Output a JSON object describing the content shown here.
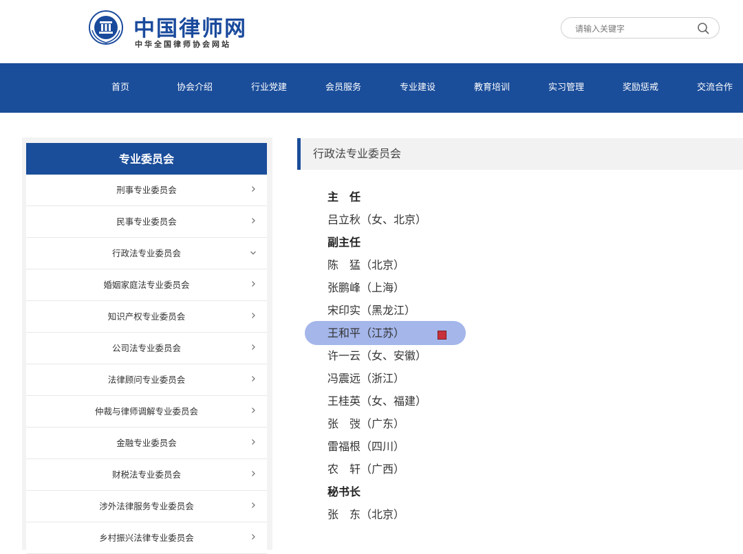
{
  "header": {
    "logo_title": "中国律师网",
    "logo_subtitle": "中华全国律师协会网站",
    "search_placeholder": "请输入关键字"
  },
  "nav": {
    "items": [
      "首页",
      "协会介绍",
      "行业党建",
      "会员服务",
      "专业建设",
      "教育培训",
      "实习管理",
      "奖励惩戒",
      "交流合作"
    ]
  },
  "sidebar": {
    "title": "专业委员会",
    "items": [
      {
        "label": "刑事专业委员会",
        "expanded": false
      },
      {
        "label": "民事专业委员会",
        "expanded": false
      },
      {
        "label": "行政法专业委员会",
        "expanded": true
      },
      {
        "label": "婚姻家庭法专业委员会",
        "expanded": false
      },
      {
        "label": "知识产权专业委员会",
        "expanded": false
      },
      {
        "label": "公司法专业委员会",
        "expanded": false
      },
      {
        "label": "法律顾问专业委员会",
        "expanded": false
      },
      {
        "label": "仲裁与律师调解专业委员会",
        "expanded": false
      },
      {
        "label": "金融专业委员会",
        "expanded": false
      },
      {
        "label": "财税法专业委员会",
        "expanded": false
      },
      {
        "label": "涉外法律服务专业委员会",
        "expanded": false
      },
      {
        "label": "乡村振兴法律专业委员会",
        "expanded": false
      }
    ]
  },
  "content": {
    "title": "行政法专业委员会",
    "lines": [
      {
        "text": "主　任",
        "role": true
      },
      {
        "text": "吕立秋（女、北京）",
        "role": false
      },
      {
        "text": "副主任",
        "role": true
      },
      {
        "text": "陈　猛（北京）",
        "role": false
      },
      {
        "text": "张鹏峰（上海）",
        "role": false
      },
      {
        "text": "宋印实（黑龙江）",
        "role": false
      },
      {
        "text": "王和平（江苏）",
        "role": false
      },
      {
        "text": "许一云（女、安徽）",
        "role": false
      },
      {
        "text": "冯震远（浙江）",
        "role": false
      },
      {
        "text": "王桂英（女、福建）",
        "role": false
      },
      {
        "text": "张　弢（广东）",
        "role": false
      },
      {
        "text": "雷福根（四川）",
        "role": false
      },
      {
        "text": "农　轩（广西）",
        "role": false
      },
      {
        "text": "秘书长",
        "role": true
      },
      {
        "text": "张　东（北京）",
        "role": false
      }
    ]
  },
  "colors": {
    "brand_blue": "#1a4d9a",
    "highlight": "#a4b6ea",
    "seal_red": "#c8313a"
  }
}
